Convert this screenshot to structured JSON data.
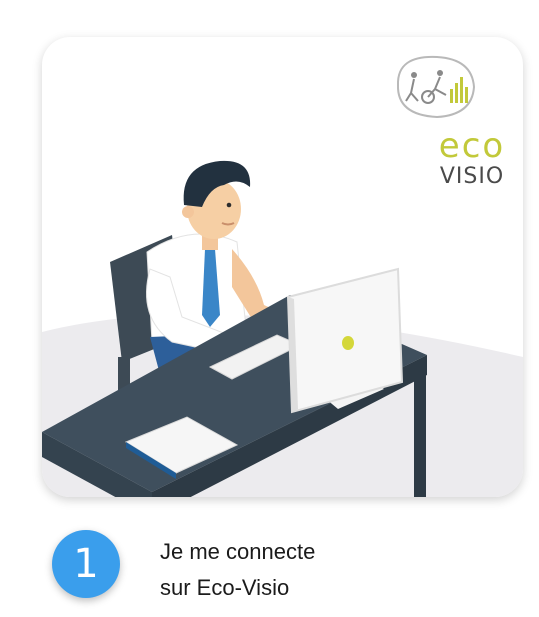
{
  "logo": {
    "brand_top": "eco",
    "brand_bottom": "VISIO",
    "icon": "cyclist-pedestrian-bars-icon",
    "colors": {
      "eco": "#c2c93a",
      "visio": "#4a4a4a"
    }
  },
  "illustration": {
    "subject": "office-worker-at-computer-illustration"
  },
  "step": {
    "number": "1",
    "line1": "Je me connecte",
    "line2": "sur Eco-Visio",
    "badge_color": "#3a9eec"
  }
}
